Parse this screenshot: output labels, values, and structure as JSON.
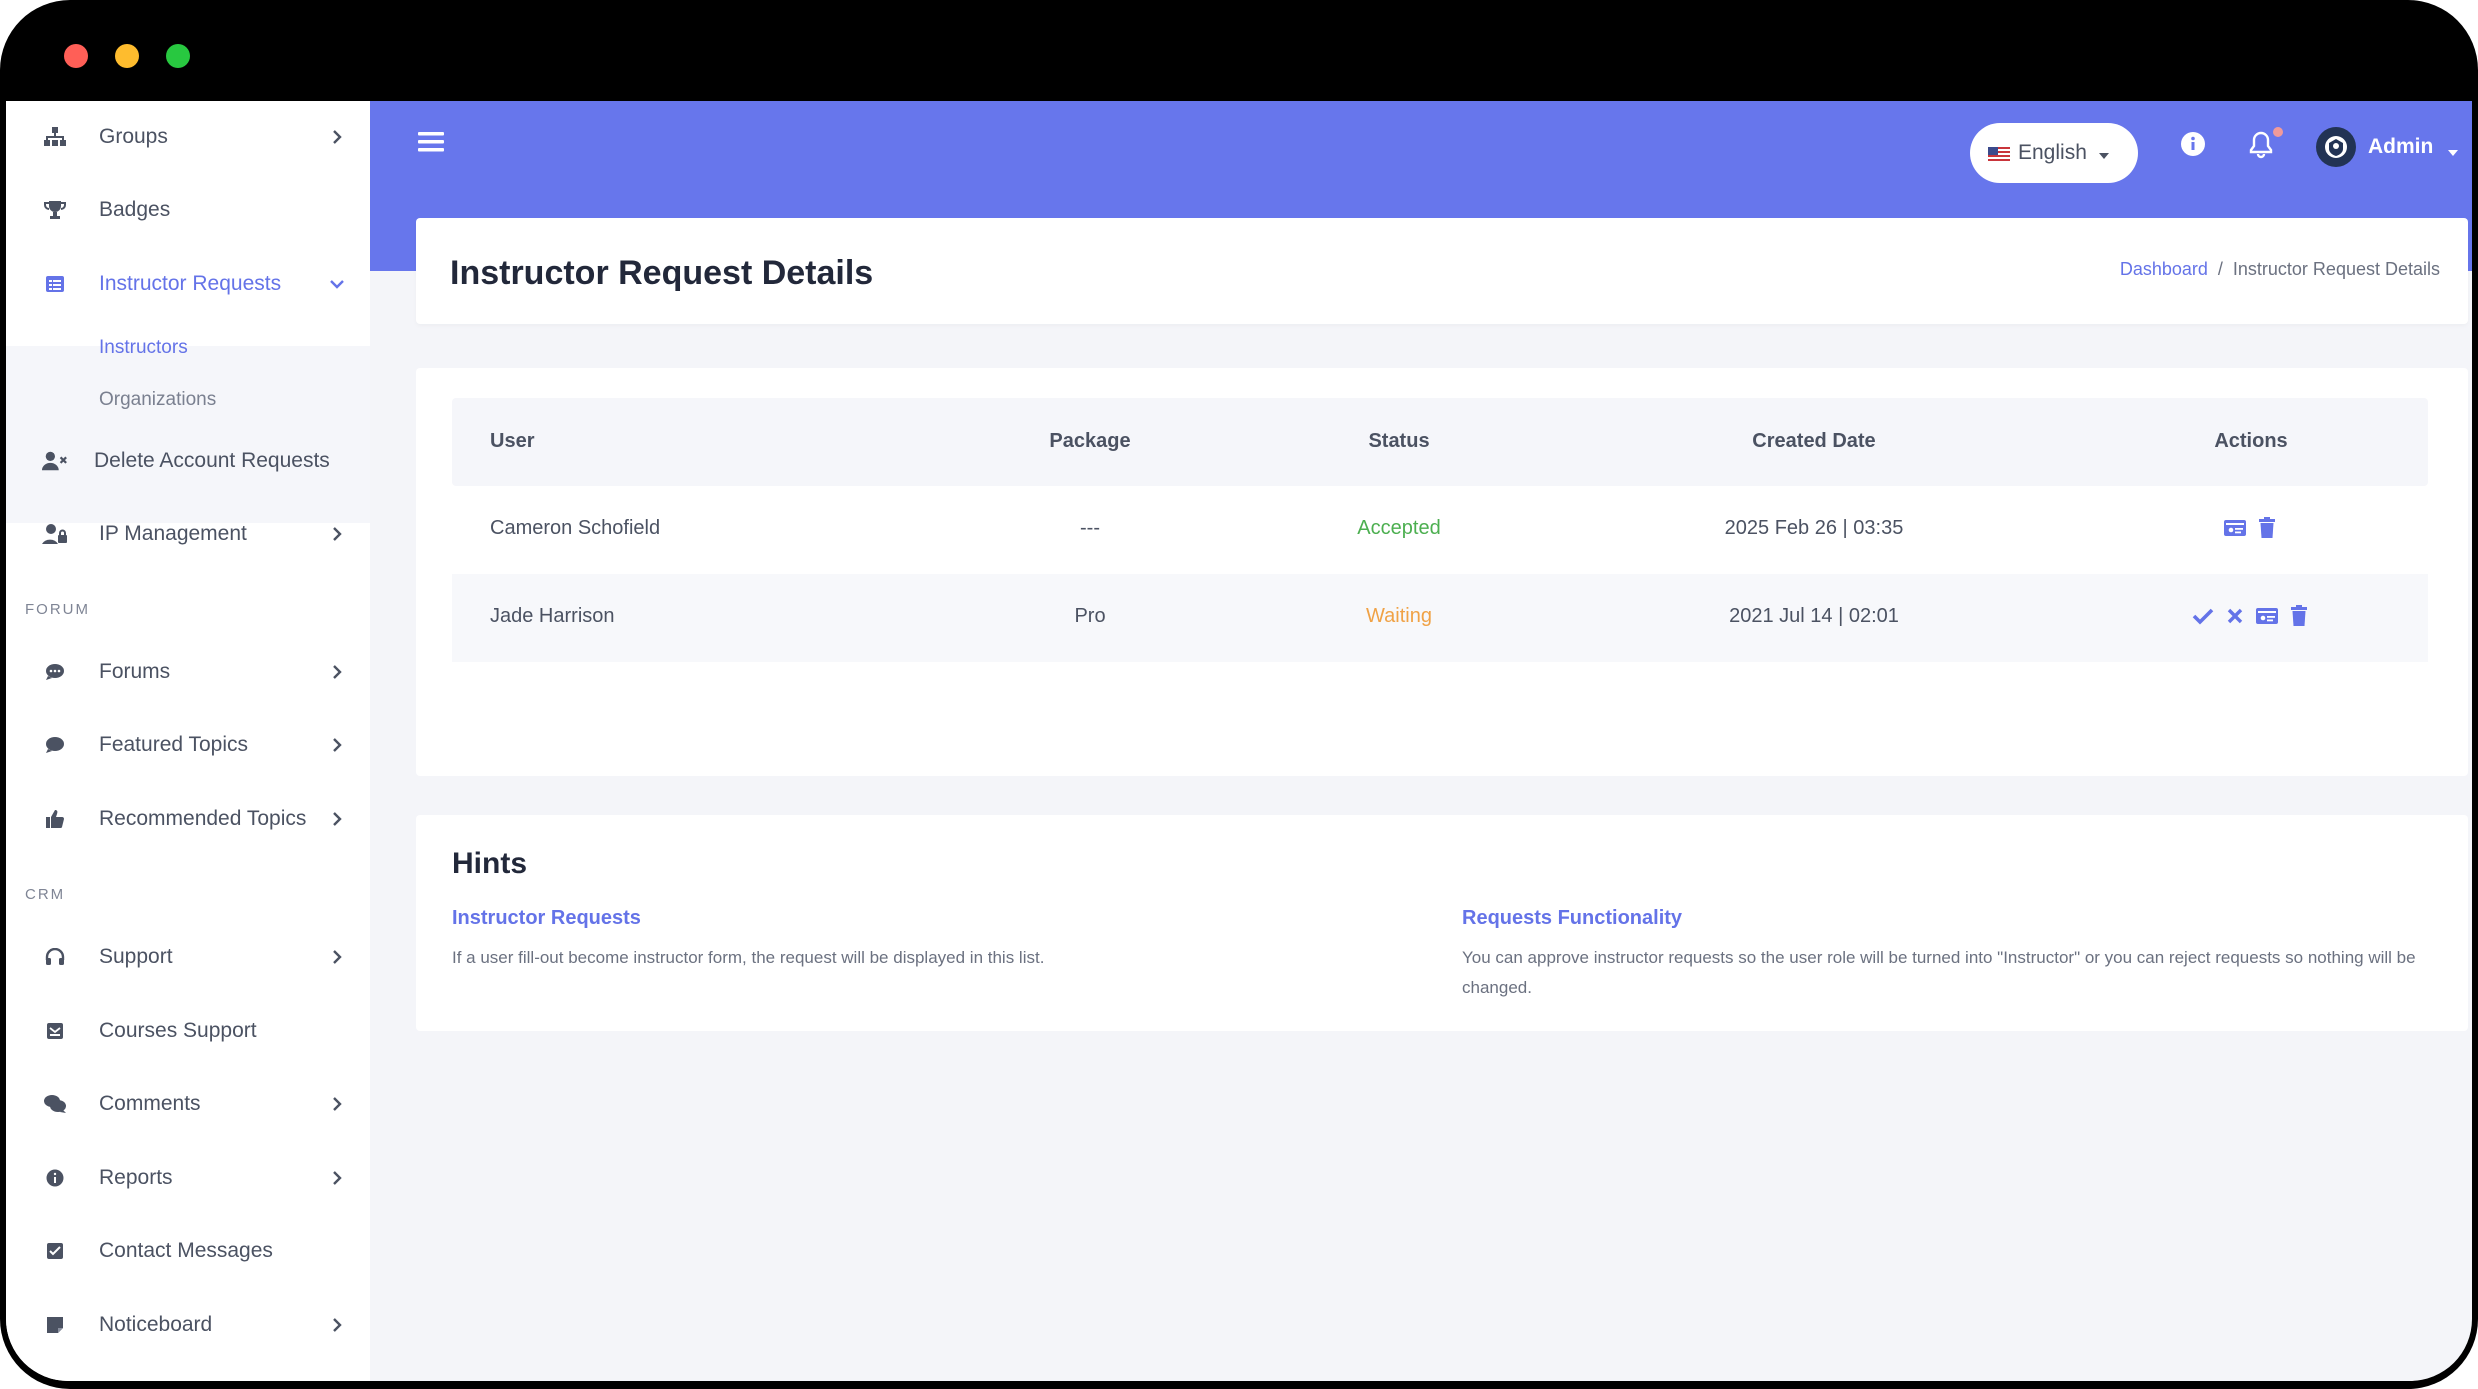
{
  "sidebar": {
    "items": [
      {
        "label": "Groups",
        "icon": "sitemap-icon"
      },
      {
        "label": "Badges",
        "icon": "trophy-icon"
      },
      {
        "label": "Instructor Requests",
        "icon": "list-icon"
      },
      {
        "label": "Delete Account Requests",
        "icon": "user-times-icon"
      },
      {
        "label": "IP Management",
        "icon": "user-lock-icon"
      },
      {
        "label": "Forums",
        "icon": "comment-icon"
      },
      {
        "label": "Featured Topics",
        "icon": "comment-icon"
      },
      {
        "label": "Recommended Topics",
        "icon": "thumbs-up-icon"
      },
      {
        "label": "Support",
        "icon": "headphones-icon"
      },
      {
        "label": "Courses Support",
        "icon": "envelope-icon"
      },
      {
        "label": "Comments",
        "icon": "comments-icon"
      },
      {
        "label": "Reports",
        "icon": "info-circle-icon"
      },
      {
        "label": "Contact Messages",
        "icon": "message-icon"
      },
      {
        "label": "Noticeboard",
        "icon": "sticky-note-icon"
      }
    ],
    "subitems": [
      {
        "label": "Instructors"
      },
      {
        "label": "Organizations"
      }
    ],
    "sections": {
      "forum": "FORUM",
      "crm": "CRM"
    }
  },
  "header": {
    "language": "English",
    "user": "Admin"
  },
  "page": {
    "title": "Instructor Request Details",
    "breadcrumb": {
      "home": "Dashboard",
      "separator": "/",
      "current": "Instructor Request Details"
    }
  },
  "table": {
    "columns": [
      "User",
      "Package",
      "Status",
      "Created Date",
      "Actions"
    ],
    "rows": [
      {
        "user": "Cameron Schofield",
        "package": "---",
        "status": "Accepted",
        "created": "2025 Feb 26 | 03:35"
      },
      {
        "user": "Jade Harrison",
        "package": "Pro",
        "status": "Waiting",
        "created": "2021 Jul 14 | 02:01"
      }
    ]
  },
  "hints": {
    "title": "Hints",
    "items": [
      {
        "heading": "Instructor Requests",
        "text": "If a user fill-out become instructor form, the request will be displayed in this list."
      },
      {
        "heading": "Requests Functionality",
        "text": "You can approve instructor requests so the user role will be turned into \"Instructor\" or you can reject requests so nothing will be changed."
      }
    ]
  },
  "colors": {
    "accent": "#6776ec",
    "link": "#6473e8",
    "accepted": "#4caf50",
    "waiting": "#f0a246"
  }
}
